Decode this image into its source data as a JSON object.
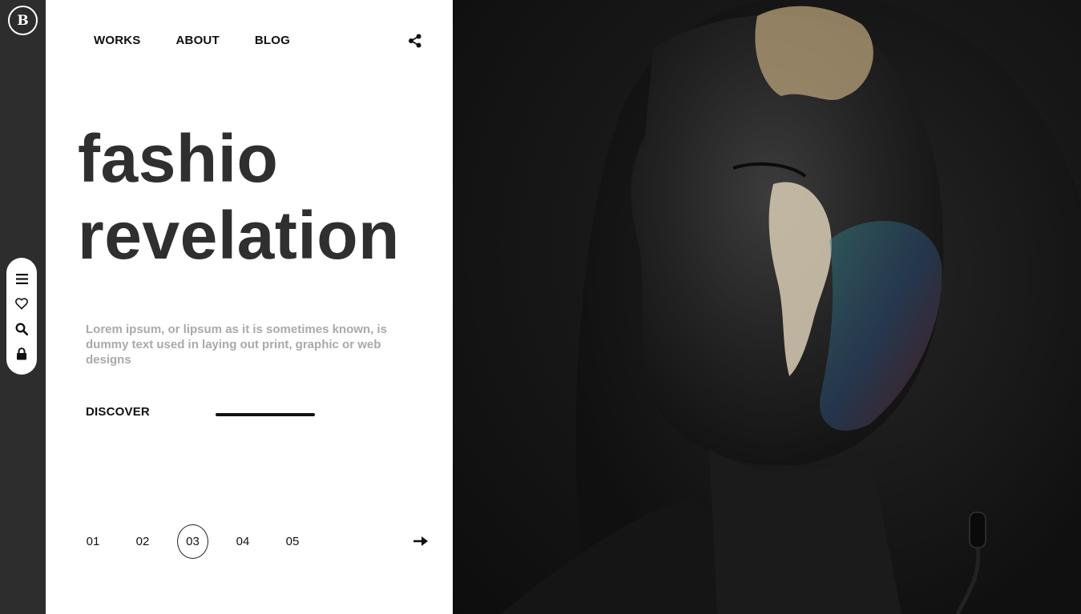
{
  "brand": {
    "logo_letter": "B"
  },
  "nav": {
    "items": [
      {
        "label": "WORKS"
      },
      {
        "label": "ABOUT"
      },
      {
        "label": "BLOG"
      }
    ],
    "share_icon": "share-icon"
  },
  "sidebar": {
    "tools": [
      {
        "icon": "menu-icon"
      },
      {
        "icon": "heart-icon"
      },
      {
        "icon": "search-icon"
      },
      {
        "icon": "lock-icon"
      }
    ]
  },
  "hero": {
    "headline_line1": "fashio",
    "headline_line2": "revelation",
    "description": "Lorem ipsum, or lipsum as it is sometimes known, is dummy text used in laying out print, graphic or web designs",
    "cta_label": "DISCOVER"
  },
  "pagination": {
    "pages": [
      "01",
      "02",
      "03",
      "04",
      "05"
    ],
    "active_index": 2,
    "next_icon": "arrow-right-icon"
  },
  "colors": {
    "rail": "#2d2d2d",
    "panel": "#ffffff",
    "headline": "#2f2f2f",
    "description": "#a9a9a9",
    "text": "#111111"
  }
}
